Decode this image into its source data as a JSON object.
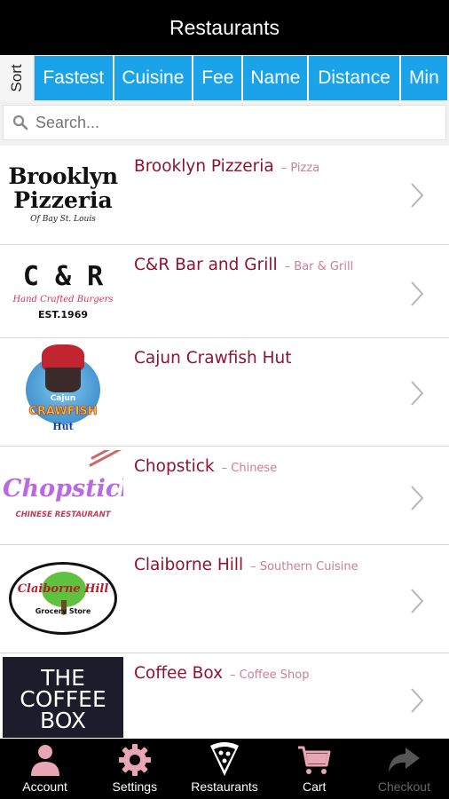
{
  "header": {
    "title": "Restaurants"
  },
  "sort": {
    "label": "Sort",
    "options": [
      "Fastest",
      "Cuisine",
      "Fee",
      "Name",
      "Distance",
      "Min"
    ]
  },
  "search": {
    "placeholder": "Search..."
  },
  "restaurants": [
    {
      "name": "Brooklyn Pizzeria",
      "category": "Pizza",
      "logo": {
        "line1": "Brooklyn",
        "line2": "Pizzeria",
        "line3": "Of Bay St. Louis"
      }
    },
    {
      "name": "C&R Bar and Grill",
      "category": "Bar & Grill",
      "logo": {
        "line1": "C & R",
        "line2": "Hand Crafted Burgers",
        "line3": "EST.1969"
      }
    },
    {
      "name": "Cajun Crawfish Hut",
      "category": "",
      "logo": {
        "line1": "Cajun",
        "line2": "CRAWFISH",
        "line3": "Hut"
      }
    },
    {
      "name": "Chopstick",
      "category": "Chinese",
      "logo": {
        "line1": "Chopstick",
        "line2": "CHINESE RESTAURANT"
      }
    },
    {
      "name": "Claiborne Hill",
      "category": "Southern Cuisine",
      "logo": {
        "line1": "Claiborne Hill",
        "line2": "Grocery Store"
      }
    },
    {
      "name": "Coffee Box",
      "category": "Coffee Shop",
      "logo": {
        "line1": "THE",
        "line2": "COFFEE",
        "line3": "BOX"
      }
    }
  ],
  "tabs": [
    {
      "label": "Account",
      "icon": "person-icon"
    },
    {
      "label": "Settings",
      "icon": "gear-icon"
    },
    {
      "label": "Restaurants",
      "icon": "pizza-slice-icon"
    },
    {
      "label": "Cart",
      "icon": "cart-icon"
    },
    {
      "label": "Checkout",
      "icon": "arrow-forward-icon"
    }
  ],
  "colors": {
    "accent": "#1aa3e8",
    "restaurant_name": "#8f1230",
    "category": "#cc7d96",
    "tab_icon": "#e8a5b4"
  }
}
